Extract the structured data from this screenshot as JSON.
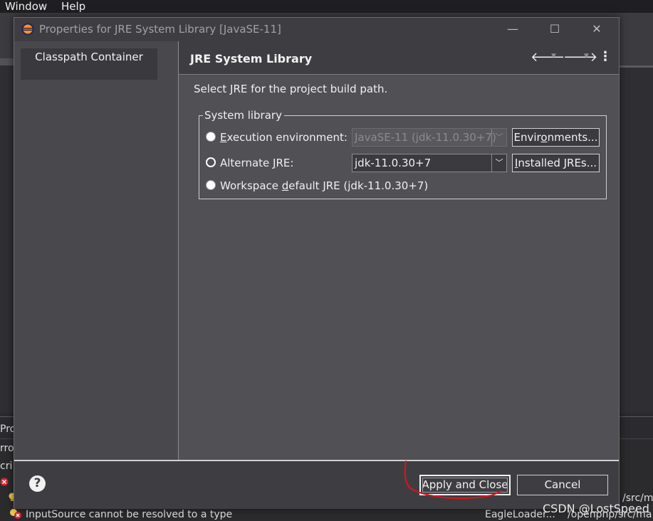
{
  "menubar": {
    "items": [
      "Window",
      "Help"
    ]
  },
  "ide": {
    "bottom_tab_fragment": "Pro",
    "row_fragments": [
      "rro",
      "cri"
    ],
    "error_text": "InputSource cannot be resolved to a type",
    "error_path_fragment": "EagleLoader...",
    "path_fragment_1": "/src/ma",
    "path_fragment_2": "/openphp/src/ma"
  },
  "dialog": {
    "title": "Properties for JRE System Library [JavaSE-11]",
    "left_tree": {
      "item": "Classpath Container"
    },
    "page": {
      "title": "JRE System Library",
      "description": "Select JRE for the project build path.",
      "group_label": "System library",
      "options": {
        "execution_environment": {
          "prefix": "",
          "mnemonic": "E",
          "suffix": "xecution environment:",
          "value": "JavaSE-11 (jdk-11.0.30+7)",
          "button": {
            "prefix": "Envir",
            "mnemonic": "o",
            "suffix": "nments..."
          }
        },
        "alternate_jre": {
          "prefix": "Alternate ",
          "mnemonic": "J",
          "suffix": "RE:",
          "value": "jdk-11.0.30+7",
          "button": {
            "prefix": "",
            "mnemonic": "I",
            "suffix": "nstalled JREs..."
          }
        },
        "workspace_default": {
          "prefix": "Workspace ",
          "mnemonic": "d",
          "suffix": "efault JRE (jdk-11.0.30+7)"
        }
      }
    },
    "footer": {
      "help_glyph": "?",
      "apply_label": "Apply and Close",
      "cancel_label": "Cancel"
    }
  },
  "watermark": "CSDN @LostSpeed",
  "colors": {
    "annotation": "#e0121a"
  }
}
